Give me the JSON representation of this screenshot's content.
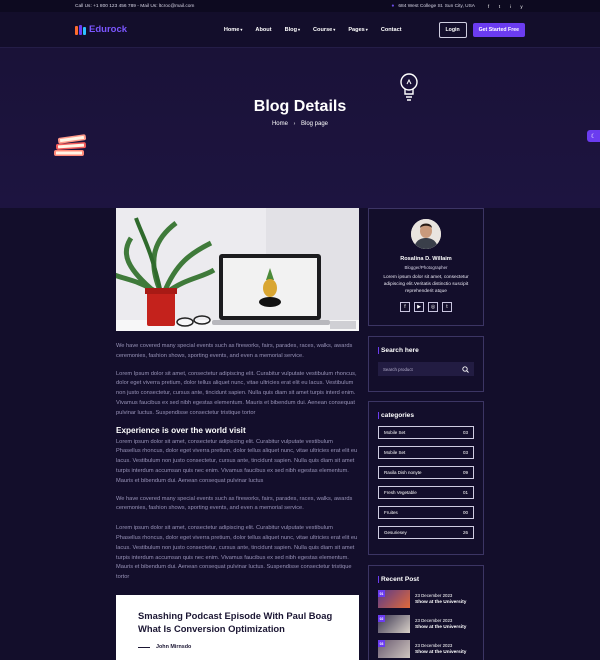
{
  "topbar": {
    "contact": "Call Us: +1 800 123 456 789 - Mail Us: ltcroc@mail.com",
    "address": "684 West College St. Sun City, USA",
    "socials": [
      "f",
      "t",
      "i",
      "y"
    ]
  },
  "nav": {
    "brand": "Edurock",
    "menu": [
      {
        "label": "Home",
        "caret": "▾"
      },
      {
        "label": "About",
        "caret": ""
      },
      {
        "label": "Blog",
        "caret": "▾"
      },
      {
        "label": "Course",
        "caret": "▾"
      },
      {
        "label": "Pages",
        "caret": "▾"
      },
      {
        "label": "Contact",
        "caret": ""
      }
    ],
    "login": "Login",
    "cta": "Get Started Free"
  },
  "hero": {
    "title": "Blog Details",
    "crumb_home": "Home",
    "crumb_sep": "›",
    "crumb_current": "Blog page"
  },
  "article": {
    "p1": "We have covered many special events such as fireworks, fairs, parades, races, walks, awards ceremonies, fashion shows, sporting events, and even a memorial service.",
    "p2": "Lorem Ipsum dolor sit amet, consectetur adipiscing elit. Curabitur vulputate vestibulum rhoncus, dolor eget viverra pretium, dolor tellus aliquet nunc, vitae ultricies erat elit eu lacus. Vestibulum non justo consectetur, cursus ante, tincidunt sapien. Nulla quis diam sit amet turpis interd enim. Vivamus faucibus ex sed nibh egestas elementum. Mauris et bibendum dui. Aenean consequat pulvinar luctus. Suspendisse consectetur tristique tortor",
    "h3": "Experience is over the world visit",
    "p3": "Lorem ipsum dolor sit amet, consectetur adipiscing elit. Curabitur vulputate vestibulum Phasellus rhoncus, dolor eget viverra pretium, dolor tellus aliquet nunc, vitae ultricies erat elit eu lacus. Vestibulum non justo consectetur, cursus ante, tincidunt sapien. Nulla quis diam sit amet turpis interdum accumsan quis nec enim. Vivamus faucibus ex sed nibh egestas elementum. Mauris et bibendum dui. Aenean consequat pulvinar luctus",
    "p4": "We have covered many special events such as fireworks, fairs, parades, races, walks, awards ceremonies, fashion shows, sporting events, and even a memorial service.",
    "p5": "Lorem ipsum dolor sit amet, consectetur adipiscing elit. Curabitur vulputate vestibulum Phasellus rhoncus, dolor eget viverra pretium, dolor tellus aliquet nunc, vitae ultricies erat elit eu lacus. Vestibulum non justo consectetur, cursus ante, tincidunt sapien. Nulla quis diam sit amet turpis interdum accumsan quis nec enim. Vivamus faucibus ex sed nibh egestas elementum. Mauris et bibendum dui. Aenean consequat pulvinar luctus. Suspendisse consectetur tristique tortor",
    "quote": "Smashing Podcast Episode With Paul Boag What Is Conversion Optimization",
    "quote_author": "John Mirnsdo"
  },
  "author": {
    "name": "Rosalina D. Willaim",
    "role": "Blogger/Photographer",
    "bio": "Lorem ipsum dolor sit amet, consectetur adipiscing elit.Veritatis distinctio suscipit reprehenderit atque",
    "socials": [
      "f",
      "▶",
      "◎",
      "t"
    ]
  },
  "search": {
    "title": "Search here",
    "placeholder": "Search product"
  },
  "categories": {
    "title": "categories",
    "items": [
      {
        "label": "Mobile Set",
        "count": "03"
      },
      {
        "label": "Mobile Set",
        "count": "03"
      },
      {
        "label": "Raxila Dish nonyte",
        "count": "09"
      },
      {
        "label": "Fresh Vegetable",
        "count": "01"
      },
      {
        "label": "Fruites",
        "count": "00"
      },
      {
        "label": "Gesuriesey",
        "count": "26"
      }
    ]
  },
  "recent": {
    "title": "Recent Post",
    "items": [
      {
        "badge": "01",
        "date": "23 December 2023",
        "title": "Show at the University"
      },
      {
        "badge": "02",
        "date": "23 December 2023",
        "title": "Show at the University"
      },
      {
        "badge": "03",
        "date": "23 December 2023",
        "title": "Show at the University"
      }
    ]
  },
  "colors": {
    "accent": "#6b3cf0",
    "bg": "#130e2b",
    "muted_text": "#9893b8"
  }
}
